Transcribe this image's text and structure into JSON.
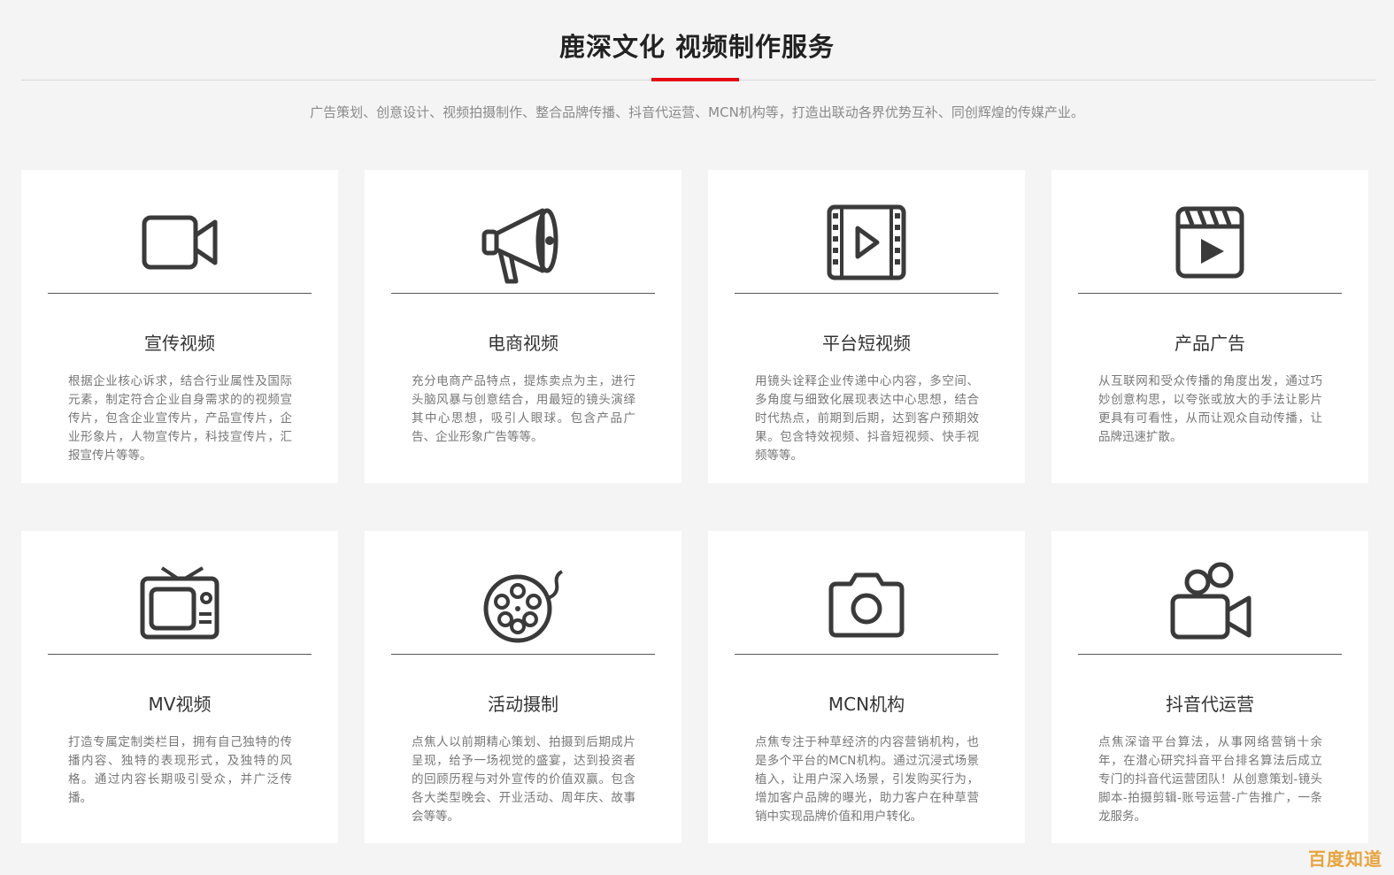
{
  "header": {
    "title": "鹿深文化 视频制作服务",
    "subtitle": "广告策划、创意设计、视频拍摄制作、整合品牌传播、抖音代运营、MCN机构等，打造出联动各界优势互补、同创辉煌的传媒产业。",
    "accent_color": "#e30613"
  },
  "services": [
    {
      "title": "宣传视频",
      "icon": "video-camera-icon",
      "desc": "根据企业核心诉求，结合行业属性及国际元素，制定符合企业自身需求的的视频宣传片，包含企业宣传片，产品宣传片，企业形象片，人物宣传片，科技宣传片，汇报宣传片等等。"
    },
    {
      "title": "电商视频",
      "icon": "megaphone-icon",
      "desc": "充分电商产品特点，提炼卖点为主，进行头脑风暴与创意结合，用最短的镜头演绎其中心思想，吸引人眼球。包含产品广告、企业形象广告等等。"
    },
    {
      "title": "平台短视频",
      "icon": "film-play-icon",
      "desc": "用镜头诠释企业传递中心内容，多空间、多角度与细致化展现表达中心思想，结合时代热点，前期到后期，达到客户预期效果。包含特效视频、抖音短视频、快手视频等等。"
    },
    {
      "title": "产品广告",
      "icon": "clapperboard-icon",
      "desc": "从互联网和受众传播的角度出发，通过巧妙创意构思，以夸张或放大的手法让影片更具有可看性，从而让观众自动传播，让品牌迅速扩散。"
    },
    {
      "title": "MV视频",
      "icon": "tv-icon",
      "desc": "打造专属定制类栏目，拥有自己独特的传播内容、独特的表现形式，及独特的风格。通过内容长期吸引受众，并广泛传播。"
    },
    {
      "title": "活动摄制",
      "icon": "film-reel-icon",
      "desc": "点焦人以前期精心策划、拍摄到后期成片呈现，给予一场视觉的盛宴，达到投资者的回顾历程与对外宣传的价值双赢。包含各大类型晚会、开业活动、周年庆、故事会等等。"
    },
    {
      "title": "MCN机构",
      "icon": "camera-icon",
      "desc": "点焦专注于种草经济的内容营销机构，也是多个平台的MCN机构。通过沉浸式场景植入，让用户深入场景，引发购买行为，增加客户品牌的曝光，助力客户在种草营销中实现品牌价值和用户转化。"
    },
    {
      "title": "抖音代运营",
      "icon": "movie-camera-icon",
      "desc": "点焦深谙平台算法，从事网络营销十余年，在潜心研究抖音平台排名算法后成立专门的抖音代运营团队！从创意策划-镜头脚本-拍摄剪辑-账号运营-广告推广，一条龙服务。"
    }
  ],
  "watermark": "百度知道"
}
